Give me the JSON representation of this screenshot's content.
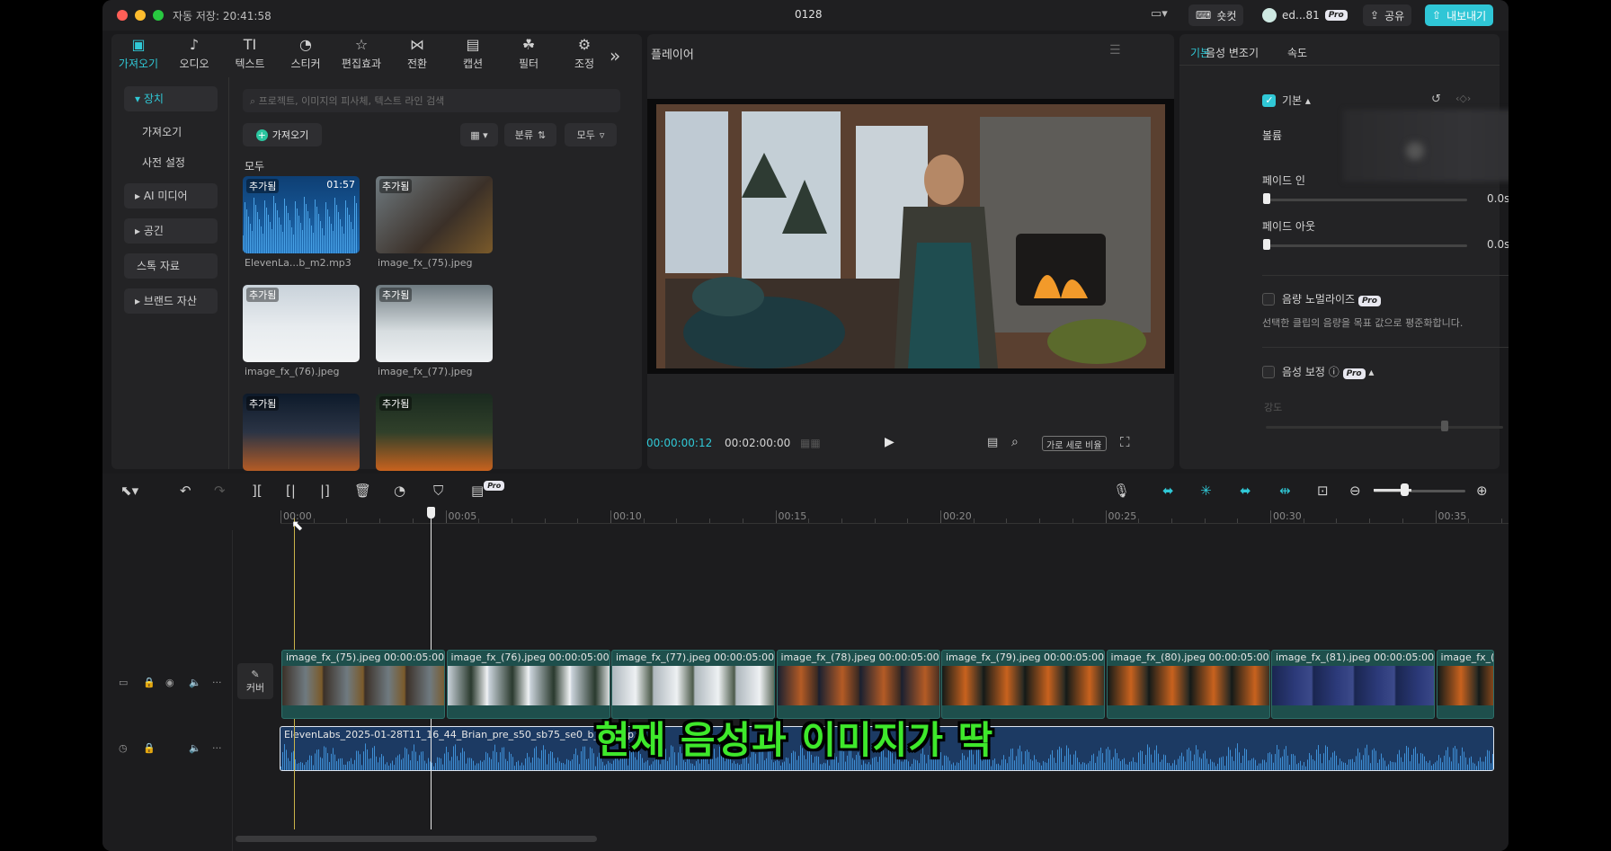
{
  "titlebar": {
    "autosave": "자동 저장: 20:41:58",
    "project": "0128",
    "shortcut": "숏컷",
    "user": "ed...81",
    "pro": "Pro",
    "share": "공유",
    "export": "내보내기"
  },
  "media_tools": [
    {
      "label": "가져오기",
      "icon": "import-icon"
    },
    {
      "label": "오디오",
      "icon": "audio-icon"
    },
    {
      "label": "텍스트",
      "icon": "text-icon",
      "glyph": "TI"
    },
    {
      "label": "스티커",
      "icon": "sticker-icon"
    },
    {
      "label": "편집효과",
      "icon": "effects-icon"
    },
    {
      "label": "전환",
      "icon": "transition-icon"
    },
    {
      "label": "캡션",
      "icon": "caption-icon"
    },
    {
      "label": "필터",
      "icon": "filter-icon"
    },
    {
      "label": "조정",
      "icon": "adjust-icon"
    }
  ],
  "sidebar": {
    "device": "장치",
    "import": "가져오기",
    "preset": "사전 설정",
    "ai_media": "AI 미디어",
    "space": "공긴",
    "stock": "스톡 자료",
    "brand": "브랜드 자산"
  },
  "media": {
    "search_placeholder": "프로젝트, 이미지의 피사체, 텍스트 라인 검색",
    "import_btn": "가져오기",
    "sort": "분류",
    "all_filter": "모두",
    "section": "모두",
    "items": [
      {
        "badge": "추가됨",
        "duration": "01:57",
        "name": "ElevenLa...b_m2.mp3"
      },
      {
        "badge": "추가됨",
        "name": "image_fx_(75).jpeg"
      },
      {
        "badge": "추가됨",
        "name": "image_fx_(76).jpeg"
      },
      {
        "badge": "추가됨",
        "name": "image_fx_(77).jpeg"
      },
      {
        "badge": "추가됨",
        "name": ""
      },
      {
        "badge": "추가됨",
        "name": ""
      }
    ]
  },
  "player": {
    "title": "플레이어",
    "current": "00:00:00:12",
    "total": "00:02:00:00",
    "ratio": "가로 세로 비율"
  },
  "properties": {
    "tabs": [
      "기본",
      "음성 변조기",
      "속도"
    ],
    "basic": "기본",
    "volume": "볼륨",
    "fade_in": "페이드 인",
    "fade_in_value": "0.0s",
    "fade_out": "페이드 아웃",
    "fade_out_value": "0.0s",
    "normalize": "음량 노멀라이즈",
    "normalize_desc": "선택한 클립의 음량을 목표 값으로 평준화합니다.",
    "enhance": "음성 보정",
    "strength": "강도",
    "strength_value": "75"
  },
  "timeline": {
    "ticks": [
      "00:00",
      "00:05",
      "00:10",
      "00:15",
      "00:20",
      "00:25",
      "00:30",
      "00:35"
    ],
    "cover": "커버",
    "clips": [
      {
        "name": "image_fx_(75).jpeg",
        "dur": "00:00:05:00",
        "scene": "cabin"
      },
      {
        "name": "image_fx_(76).jpeg",
        "dur": "00:00:05:00",
        "scene": "forest"
      },
      {
        "name": "image_fx_(77).jpeg",
        "dur": "00:00:05:00",
        "scene": "stream"
      },
      {
        "name": "image_fx_(78).jpeg",
        "dur": "00:00:05:00",
        "scene": "sunset"
      },
      {
        "name": "image_fx_(79).jpeg",
        "dur": "00:00:05:00",
        "scene": "fire"
      },
      {
        "name": "image_fx_(80).jpeg",
        "dur": "00:00:05:00",
        "scene": "fire"
      },
      {
        "name": "image_fx_(81).jpeg",
        "dur": "00:00:05:00",
        "scene": "night"
      },
      {
        "name": "image_fx_(",
        "dur": "",
        "scene": "fire"
      }
    ],
    "audio_clip": "ElevenLabs_2025-01-28T11_16_44_Brian_pre_s50_sb75_se0_b_m2.mp3",
    "subtitle": "현재 음성과 이미지가 딱"
  },
  "colors": {
    "accent": "#30c8d6",
    "export_bg": "#2fc6d6",
    "subtitle": "#3ee82b"
  }
}
